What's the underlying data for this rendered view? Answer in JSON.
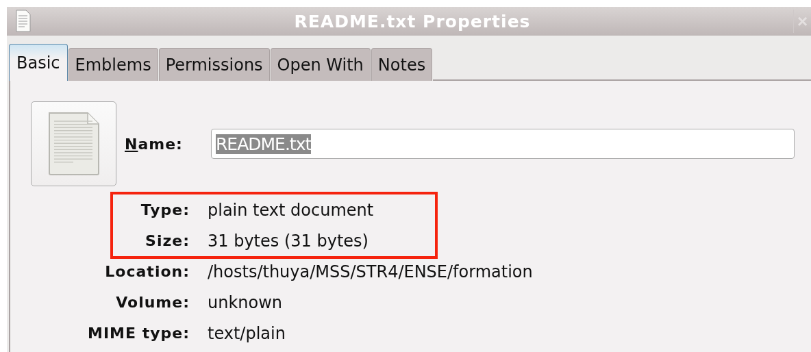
{
  "window": {
    "title": "README.txt Properties",
    "close": "×"
  },
  "tabs": [
    {
      "label": "Basic",
      "selected": true
    },
    {
      "label": "Emblems",
      "selected": false
    },
    {
      "label": "Permissions",
      "selected": false
    },
    {
      "label": "Open With",
      "selected": false
    },
    {
      "label": "Notes",
      "selected": false
    }
  ],
  "name": {
    "label": "Name:",
    "mnemonic": true,
    "value": "README.txt",
    "text_selected": true
  },
  "properties": [
    {
      "label": "Type:",
      "value": "plain text document",
      "highlighted": true
    },
    {
      "label": "Size:",
      "value": "31 bytes (31 bytes)",
      "highlighted": true
    },
    {
      "label": "Location:",
      "value": "/hosts/thuya/MSS/STR4/ENSE/formation",
      "highlighted": false
    },
    {
      "label": "Volume:",
      "value": "unknown",
      "highlighted": false
    },
    {
      "label": "MIME type:",
      "value": "text/plain",
      "highlighted": false
    }
  ]
}
